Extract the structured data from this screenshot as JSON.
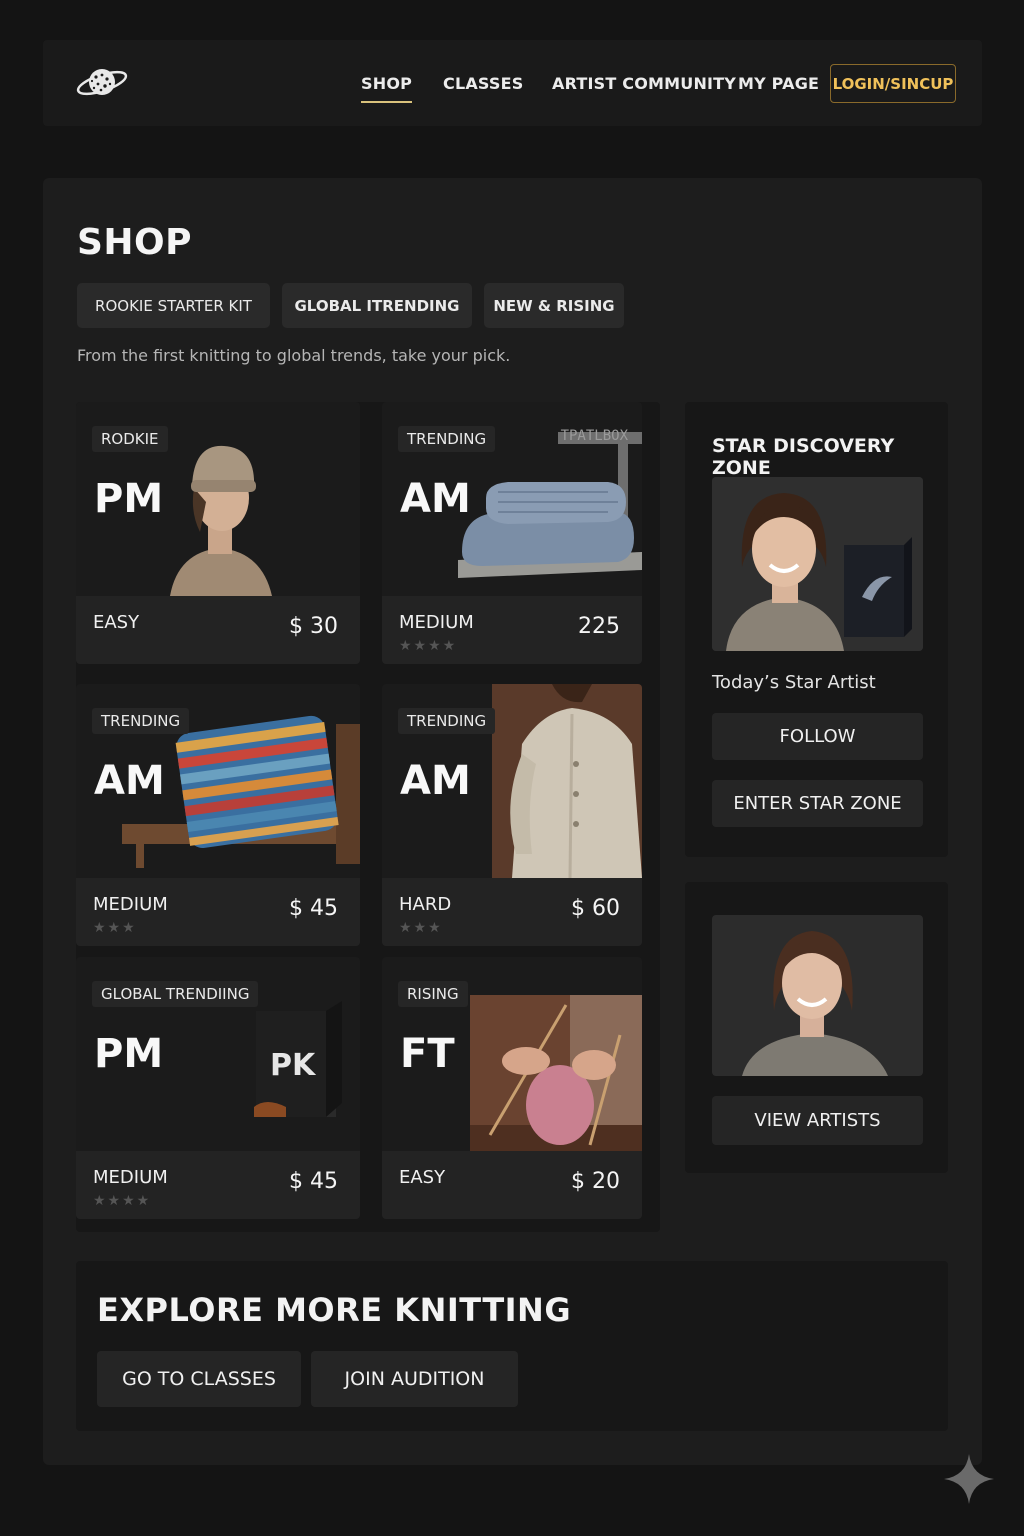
{
  "nav": {
    "items": [
      "SHOP",
      "CLASSES",
      "ARTIST COMMUNITY",
      "MY PAGE"
    ],
    "login": "LOGIN/SINCUP",
    "accent": "#f0c15a"
  },
  "shop": {
    "title": "SHOP",
    "tabs": [
      "ROOKIE STARTER KIT",
      "GLOBAL ITRENDING",
      "NEW & RISING"
    ],
    "subtitle": "From the first knitting to global trends, take your pick."
  },
  "cards": [
    {
      "badge": "RODKIE",
      "code": "PM",
      "difficulty": "EASY",
      "price": "$ 30",
      "image": "woman-in-beanie"
    },
    {
      "badge": "TRENDING",
      "code": "AM",
      "difficulty": "MEDIUM",
      "price": "225",
      "stars": "★★★★",
      "watermark": "TPATLBOX",
      "image": "folded-blue-blanket"
    },
    {
      "badge": "TRENDING",
      "code": "AM",
      "difficulty": "MEDIUM",
      "price": "$ 45",
      "stars": "★★★",
      "image": "striped-cushion"
    },
    {
      "badge": "TRENDING",
      "code": "AM",
      "difficulty": "HARD",
      "price": "$ 60",
      "stars": "★★★",
      "image": "cardigan"
    },
    {
      "badge": "GLOBAL TRENDIING",
      "code": "PM",
      "difficulty": "MEDIUM",
      "price": "$ 45",
      "stars": "★★★★",
      "image": "kit-box"
    },
    {
      "badge": "RISING",
      "code": "FT",
      "difficulty": "EASY",
      "price": "$ 20",
      "image": "hands-knitting"
    }
  ],
  "star_zone": {
    "title": "STAR DISCOVERY ZONE",
    "caption": "Today’s Star Artist",
    "follow": "FOLLOW",
    "enter": "ENTER STAR ZONE"
  },
  "artists": {
    "view": "VIEW ARTISTS"
  },
  "explore": {
    "title": "EXPLORE MORE KNITTING",
    "classes": "GO TO CLASSES",
    "audition": "JOIN AUDITION"
  }
}
